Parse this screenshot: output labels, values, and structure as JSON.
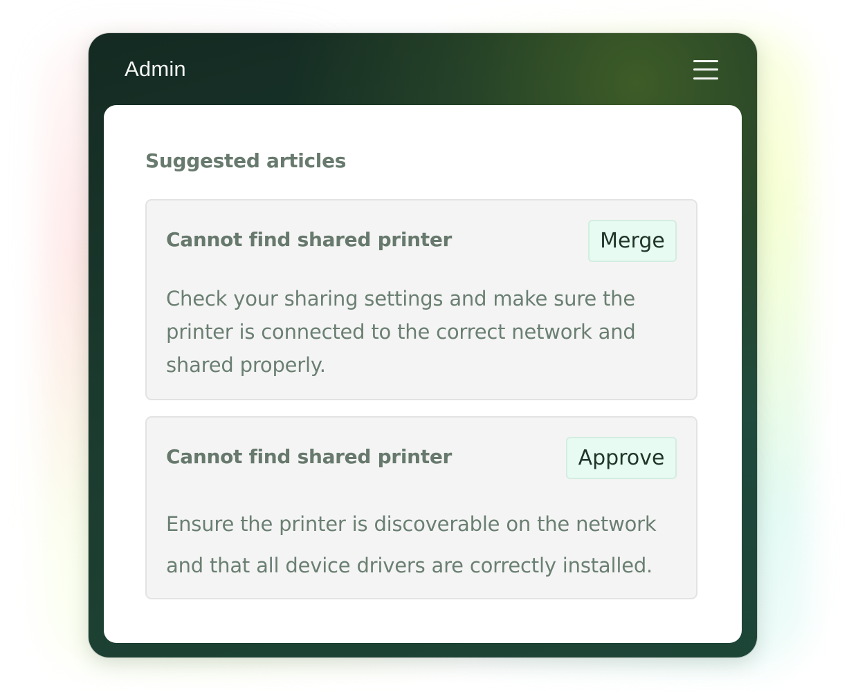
{
  "header": {
    "title": "Admin",
    "menu_icon": "hamburger-menu-icon"
  },
  "section": {
    "title": "Suggested articles"
  },
  "articles": [
    {
      "title": "Cannot find shared printer",
      "action_label": "Merge",
      "body": "Check your sharing settings and make sure the printer is connected to the correct network and shared properly."
    },
    {
      "title": "Cannot find shared printer",
      "action_label": "Approve",
      "body": "Ensure the printer is discoverable on the network and that all device drivers are correctly installed."
    }
  ],
  "colors": {
    "header_bg": "#1b3a2e",
    "card_bg": "#f4f4f4",
    "button_bg": "#e8fbf3",
    "muted_text": "#687a6e"
  }
}
